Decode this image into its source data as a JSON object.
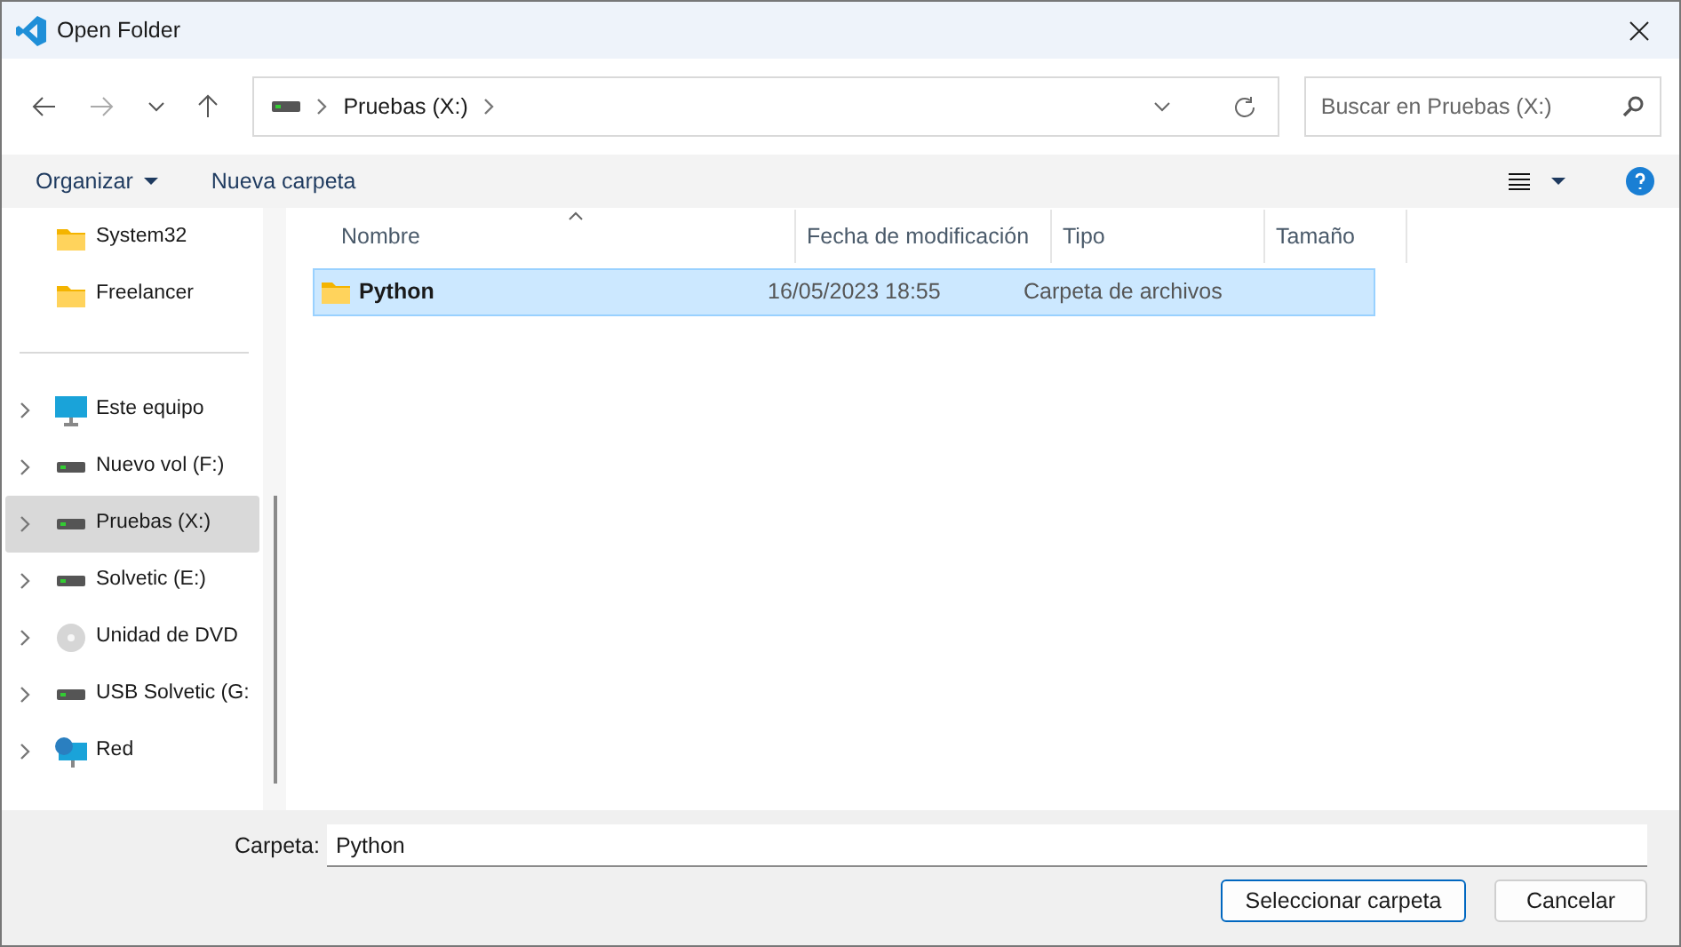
{
  "window": {
    "title": "Open Folder"
  },
  "address": {
    "segments": [
      "Pruebas (X:)"
    ]
  },
  "search": {
    "placeholder": "Buscar en Pruebas (X:)"
  },
  "toolbar": {
    "organize": "Organizar",
    "new_folder": "Nueva carpeta"
  },
  "sidebar": {
    "items": [
      {
        "label": "System32",
        "kind": "folder",
        "expandable": false,
        "selected": false
      },
      {
        "label": "Freelancer",
        "kind": "folder",
        "expandable": false,
        "selected": false
      },
      {
        "kind": "divider"
      },
      {
        "label": "Este equipo",
        "kind": "computer",
        "expandable": true,
        "selected": false
      },
      {
        "label": "Nuevo vol (F:)",
        "kind": "drive",
        "expandable": true,
        "selected": false
      },
      {
        "label": "Pruebas (X:)",
        "kind": "drive",
        "expandable": true,
        "selected": true
      },
      {
        "label": "Solvetic (E:)",
        "kind": "drive",
        "expandable": true,
        "selected": false
      },
      {
        "label": "Unidad de DVD",
        "kind": "dvd",
        "expandable": true,
        "selected": false
      },
      {
        "label": "USB Solvetic (G:",
        "kind": "drive",
        "expandable": true,
        "selected": false
      },
      {
        "label": "Red",
        "kind": "network",
        "expandable": true,
        "selected": false
      }
    ]
  },
  "table": {
    "columns": [
      "Nombre",
      "Fecha de modificación",
      "Tipo",
      "Tamaño"
    ],
    "rows": [
      {
        "name": "Python",
        "modified": "16/05/2023 18:55",
        "type": "Carpeta de archivos",
        "selected": true
      }
    ]
  },
  "footer": {
    "folder_label": "Carpeta:",
    "folder_value": "Python",
    "buttons": [
      "Seleccionar carpeta",
      "Cancelar"
    ]
  }
}
